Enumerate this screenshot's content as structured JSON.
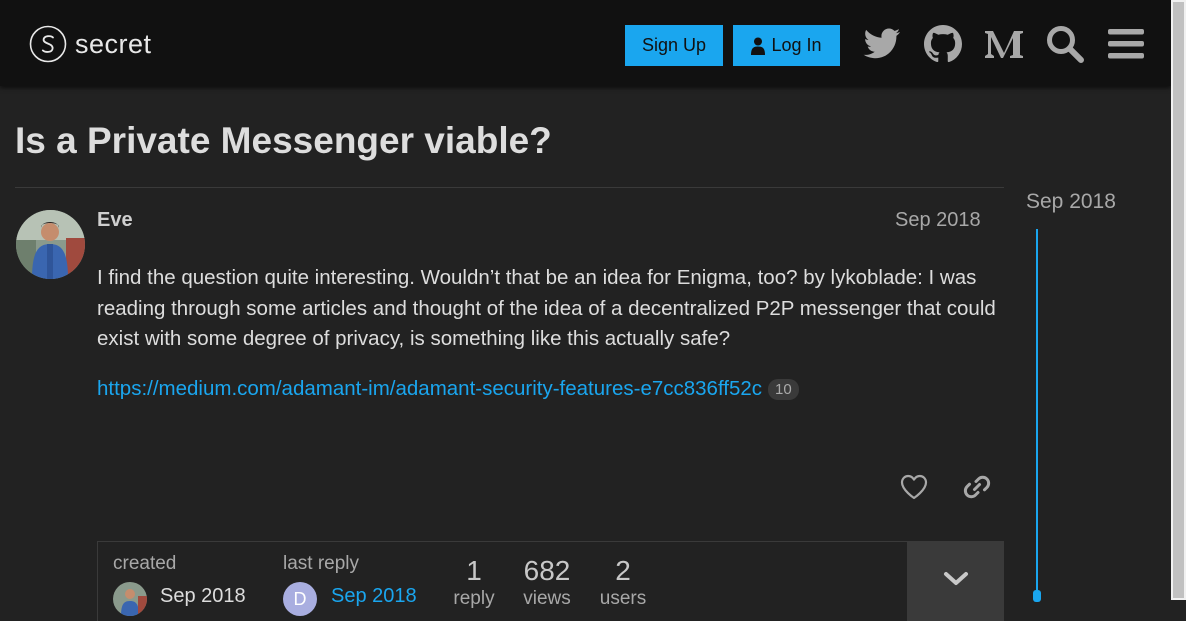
{
  "header": {
    "logo_text": "secret",
    "signup_label": "Sign Up",
    "login_label": "Log In",
    "icons": [
      "twitter-icon",
      "github-icon",
      "medium-icon",
      "search-icon",
      "hamburger-menu-icon"
    ]
  },
  "topic": {
    "title": "Is a Private Messenger viable?"
  },
  "post": {
    "username": "Eve",
    "date": "Sep 2018",
    "body": "I find the question quite interesting. Wouldn’t that be an idea for Enigma, too? by lykoblade: I was reading through some articles and thought of the idea of a decentralized P2P messenger that could exist with some degree of privacy, is something like this actually safe?",
    "link": "https://medium.com/adamant-im/adamant-security-features-e7cc836ff52c",
    "link_clicks": "10"
  },
  "topic_map": {
    "created_label": "created",
    "created_date": "Sep 2018",
    "last_reply_label": "last reply",
    "last_reply_date": "Sep 2018",
    "last_reply_avatar_letter": "D",
    "replies_count": "1",
    "replies_label": "reply",
    "views_count": "682",
    "views_label": "views",
    "users_count": "2",
    "users_label": "users"
  },
  "timeline": {
    "date": "Sep 2018"
  },
  "colors": {
    "accent": "#1aa6ef",
    "background": "#222222",
    "header": "#111111"
  }
}
